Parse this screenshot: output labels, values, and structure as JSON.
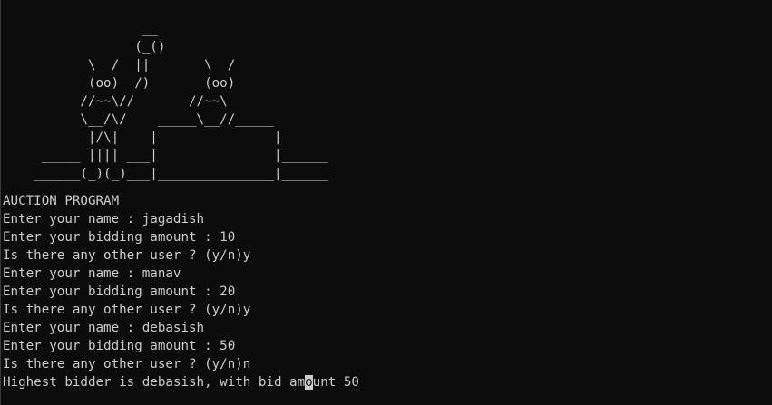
{
  "ascii_art": [
    "                  __",
    "                 (_()",
    "           \\__/  ||       \\__/",
    "           (oo)  /)       (oo)",
    "          //~~\\//       //~~\\",
    "          \\__/\\/    _____\\__//_____",
    "           |/\\|    |               |",
    "     _____ |||| ___|               |______",
    "    ______(_)(_)___|_______________|______"
  ],
  "blank_line": "",
  "output_lines": [
    "AUCTION PROGRAM",
    "Enter your name : jagadish",
    "Enter your bidding amount : 10",
    "Is there any other user ? (y/n)y",
    "Enter your name : manav",
    "Enter your bidding amount : 20",
    "Is there any other user ? (y/n)y",
    "Enter your name : debasish",
    "Enter your bidding amount : 50",
    "Is there any other user ? (y/n)n"
  ],
  "final_line": {
    "before_cursor": "Highest bidder is debasish, with bid am",
    "cursor_char": "o",
    "after_cursor": "unt 50"
  }
}
